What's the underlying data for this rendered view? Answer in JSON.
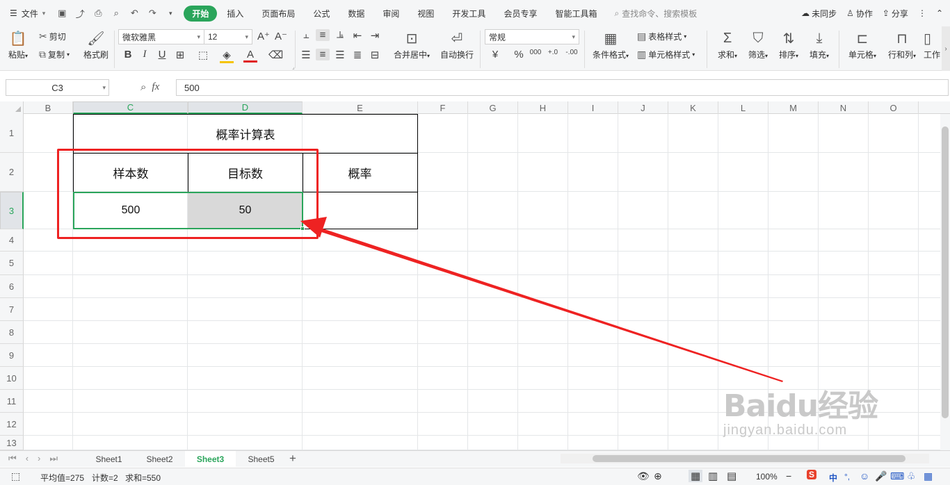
{
  "menubar": {
    "file_label": "文件",
    "tabs": [
      "开始",
      "插入",
      "页面布局",
      "公式",
      "数据",
      "审阅",
      "视图",
      "开发工具",
      "会员专享",
      "智能工具箱"
    ],
    "active_tab": 0,
    "search_placeholder": "查找命令、搜索模板",
    "sync": "未同步",
    "collab": "协作",
    "share": "分享"
  },
  "ribbon": {
    "paste": "粘贴",
    "cut": "剪切",
    "copy": "复制",
    "format_painter": "格式刷",
    "font_name": "微软雅黑",
    "font_size": "12",
    "merge_center": "合并居中",
    "wrap_text": "自动换行",
    "number_format": "常规",
    "currency": "¥",
    "percent": "%",
    "thousands": "000",
    "dec_inc": "+.0",
    "dec_dec": "-.00",
    "conditional_format": "条件格式",
    "table_style": "表格样式",
    "cell_style": "单元格样式",
    "sum": "求和",
    "filter": "筛选",
    "sort": "排序",
    "fill": "填充",
    "cell": "单元格",
    "row_col": "行和列",
    "worksheet": "工作"
  },
  "formula_bar": {
    "name_box": "C3",
    "fx": "fx",
    "value": "500"
  },
  "grid": {
    "columns": [
      "B",
      "C",
      "D",
      "E",
      "F",
      "G",
      "H",
      "I",
      "J",
      "K",
      "L",
      "M",
      "N",
      "O"
    ],
    "rows": [
      "1",
      "2",
      "3",
      "4",
      "5",
      "6",
      "7",
      "8",
      "9",
      "10",
      "11",
      "12",
      "13"
    ],
    "selected_column": "C",
    "selected_row": "3",
    "table": {
      "title": "概率计算表",
      "header_sample": "样本数",
      "header_target": "目标数",
      "header_prob": "概率",
      "value_sample": "500",
      "value_target": "50",
      "value_prob": ""
    }
  },
  "sheets": [
    "Sheet1",
    "Sheet2",
    "Sheet3",
    "Sheet5"
  ],
  "active_sheet": 2,
  "status": {
    "average": "平均值=275",
    "count": "计数=2",
    "sum": "求和=550",
    "zoom": "100%"
  },
  "watermark": {
    "brand": "Baidu经验",
    "url": "jingyan.baidu.com"
  },
  "colors": {
    "accent": "#2aa55b",
    "annotation": "#ee2222",
    "selected_cell_fill": "#d9d9d9"
  }
}
